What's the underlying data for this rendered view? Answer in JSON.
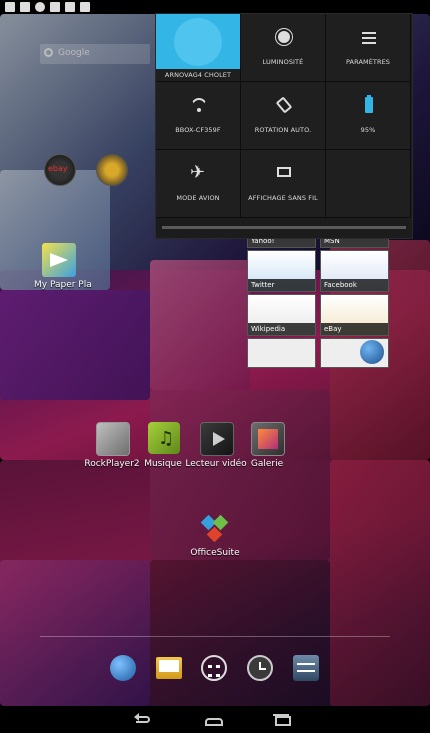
{
  "status_bar": {
    "icons": [
      "gallery-icon",
      "image-icon",
      "chat-icon",
      "play-icon",
      "play-icon",
      "play-icon"
    ]
  },
  "search": {
    "label": "Google"
  },
  "quick_settings": {
    "user_name": "ARNOVAG4 CHOLET",
    "brightness_label": "LUMINOSITÉ",
    "settings_label": "PARAMÈTRES",
    "wifi_label": "BBOX-CF359F",
    "rotation_label": "ROTATION AUTO.",
    "battery_label": "95%",
    "airplane_label": "MODE AVION",
    "cast_label": "AFFICHAGE SANS FIL",
    "accent_color": "#33b5e5"
  },
  "desktop": {
    "folder_labels": [
      "ebay"
    ],
    "widget_label": "My Paper Pla"
  },
  "bookmarks": [
    {
      "label": "Yahoo!"
    },
    {
      "label": "MSN"
    },
    {
      "label": "Twitter"
    },
    {
      "label": "Facebook"
    },
    {
      "label": "Wikipedia"
    },
    {
      "label": "eBay"
    }
  ],
  "apps": [
    {
      "label": "RockPlayer2"
    },
    {
      "label": "Musique"
    },
    {
      "label": "Lecteur vidéo"
    },
    {
      "label": "Galerie"
    }
  ],
  "office": {
    "label": "OfficeSuite"
  },
  "dock": [
    "browser-icon",
    "email-icon",
    "all-apps-icon",
    "clock-icon",
    "settings-icon"
  ],
  "nav": [
    "back-icon",
    "home-icon",
    "recent-apps-icon"
  ]
}
